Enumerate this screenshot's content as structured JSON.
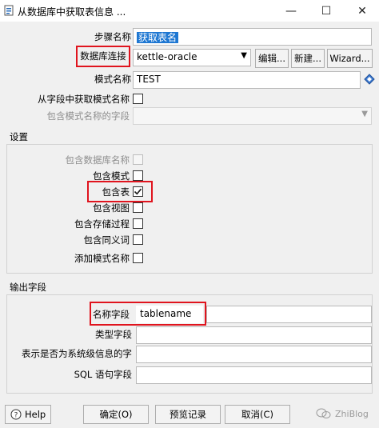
{
  "window": {
    "title": "从数据库中获取表信息 ...",
    "min_glyph": "—",
    "max_glyph": "☐",
    "close_glyph": "✕"
  },
  "form": {
    "step_name_label": "步骤名称",
    "step_name_value": "获取表名",
    "db_conn_label": "数据库连接",
    "db_conn_value": "kettle-oracle",
    "edit_button": "编辑...",
    "new_button": "新建...",
    "wizard_button": "Wizard...",
    "schema_label": "模式名称",
    "schema_value": "TEST",
    "schema_from_field_label": "从字段中获取模式名称",
    "schema_field_label": "包含模式名称的字段"
  },
  "settings": {
    "title": "设置",
    "items": [
      {
        "label": "包含数据库名称",
        "checked": false,
        "disabled": true
      },
      {
        "label": "包含模式",
        "checked": false,
        "disabled": false
      },
      {
        "label": "包含表",
        "checked": true,
        "disabled": false
      },
      {
        "label": "包含视图",
        "checked": false,
        "disabled": false
      },
      {
        "label": "包含存储过程",
        "checked": false,
        "disabled": false
      },
      {
        "label": "包含同义词",
        "checked": false,
        "disabled": false
      },
      {
        "label": "添加模式名称",
        "checked": false,
        "disabled": false
      }
    ]
  },
  "output": {
    "title": "输出字段",
    "name_field_label": "名称字段",
    "name_field_value": "tablename",
    "type_field_label": "类型字段",
    "system_info_label": "表示是否为系统级信息的字",
    "sql_field_label": "SQL 语句字段"
  },
  "footer": {
    "help_button": "Help",
    "ok_button": "确定(O)",
    "preview_button": "预览记录",
    "cancel_button": "取消(C)"
  },
  "watermark": "ZhiBlog",
  "colors": {
    "highlight_box": "#e0141e",
    "selection": "#1e77d2"
  }
}
